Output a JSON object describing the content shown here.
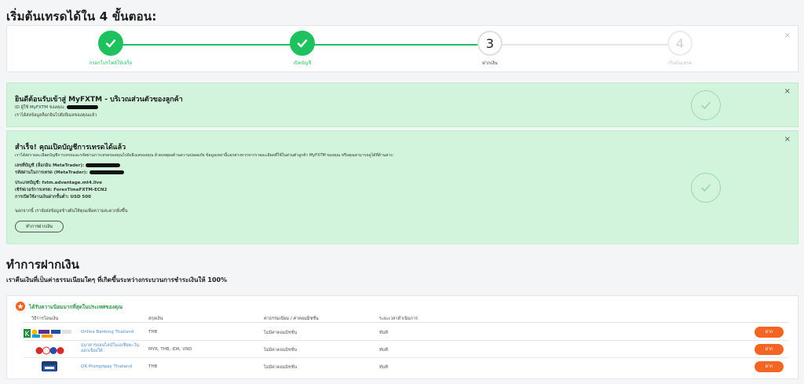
{
  "page_title": "เริ่มต้นเทรดได้ใน 4 ขั้นตอน:",
  "stepper": {
    "close_glyph": "×",
    "steps": [
      {
        "number": "✓",
        "label": "กรอกโปรไฟล์ให้เสร็จ",
        "state": "done"
      },
      {
        "number": "✓",
        "label": "เปิดบัญชี",
        "state": "done"
      },
      {
        "number": "3",
        "label": "ฝากเงิน",
        "state": "current"
      },
      {
        "number": "4",
        "label": "เริ่มต้นเทรด",
        "state": "todo"
      }
    ]
  },
  "welcome_panel": {
    "title": "ยินดีต้อนรับเข้าสู่ MyFXTM - บริเวณส่วนตัวของลูกค้า",
    "id_line": "ID ผู้ใช้ MyFXTM ของคุณ:",
    "sent_line": "เราได้ส่งข้อมูลล็อกอินไปยังอีเมลของคุณแล้ว",
    "close_glyph": "×"
  },
  "account_panel": {
    "title": "สำเร็จ! คุณเปิดบัญชีการเทรดได้แล้ว",
    "intro": "เราได้ส่งรายละเอียดบัญชีการเทรดและรหัสผ่านการเทรดของคุณไปยังอีเมลของคุณ ด้วยเหตุผลด้านความปลอดภัย ข้อมูลเหล่านี้แยกต่างหากจากรายละเอียดที่ใช้ในส่วนตัวลูกค้า MyFXTM ของคุณ หรือคุณสามารถดูได้ที่ด้านล่าง:",
    "account_no_label": "เลขที่บัญชี (ล็อกอิน MetaTrader):",
    "password_label": "รหัสผ่านในการเทรด (MetaTrader):",
    "account_type": "ประเภทบัญชี: fstm.advantage.mt4.live",
    "server": "เซิร์ฟเวอร์การเทรด: ForexTimeFXTM-ECN2",
    "min_deposit": "การเปิดใช้งานเงินฝากขั้นต่ำ: USD 500",
    "note": "นอกจากนี้ เรายังส่งข้อมูลข้างต้นให้คุณเพื่อความสะดวกยิ่งขึ้น",
    "deposit_button": "ทำการฝากเงิน",
    "close_glyph": "×"
  },
  "deposit": {
    "title": "ทำการฝากเงิน",
    "subtitle": "เราคืนเงินที่เป็นค่าธรรมเนียมใดๆ ที่เกิดขึ้นระหว่างกระบวนการชำระเงินให้ 100%",
    "recommended_label": "ได้รับความนิยมมากที่สุดในประเทศของคุณ",
    "badge_icon": "star-icon",
    "columns": [
      "วิธีการโอนเงิน",
      "สกุลเงิน",
      "ค่าธรรมเนียม / ค่าคอมมิชชั่น",
      "ระยะเวลาดำเนินการ"
    ],
    "rows": [
      {
        "name": "Online Banking Thailand",
        "currency": "THB",
        "fee": "ไม่มีค่าคอมมิชชั่น",
        "time": "ทันที",
        "button": "ฝาก",
        "logo": "thai-banks-logo"
      },
      {
        "name": "ธนาคารออนไลน์ในเอเชียตะวันออกเฉียงใต้",
        "currency": "MYR, THB, IDR, VND",
        "fee": "ไม่มีค่าคอมมิชชั่น",
        "time": "ทันที",
        "button": "ฝาก",
        "logo": "sea-banks-logo"
      },
      {
        "name": "QR Promptpay Thailand",
        "currency": "THB",
        "fee": "ไม่มีค่าคอมมิชชั่น",
        "time": "ทันที",
        "button": "ฝาก",
        "logo": "promptpay-logo"
      }
    ]
  },
  "colors": {
    "green": "#1ec15e",
    "panel_bg": "#d2f4dc",
    "orange": "#f26522",
    "link": "#4a8fd1"
  }
}
